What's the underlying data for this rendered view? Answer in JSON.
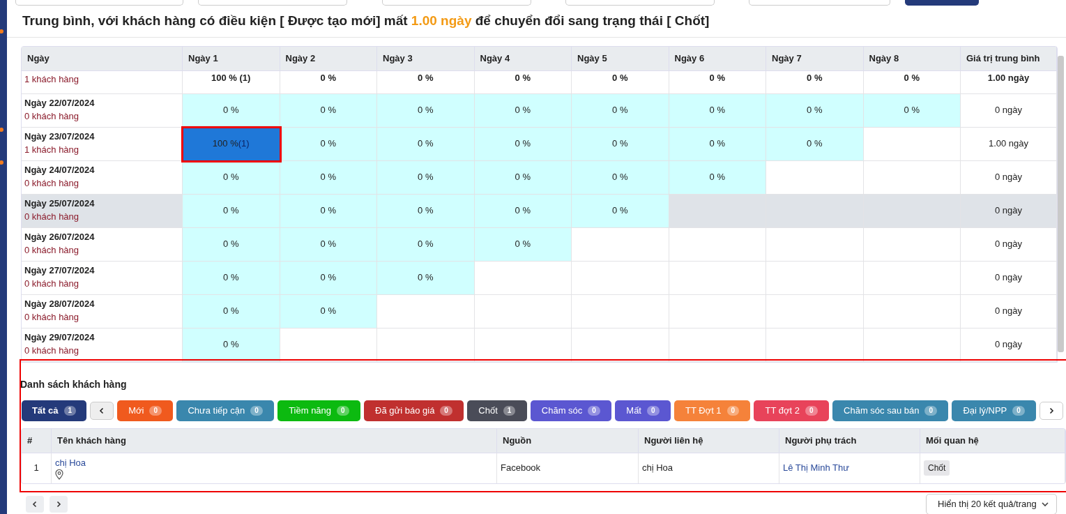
{
  "headline": {
    "before": "Trung bình, với khách hàng có điều kiện [ Được tạo mới] mất",
    "value": "1.00 ngày",
    "after": "để chuyển đổi sang trạng thái [ Chốt]"
  },
  "cohort_table": {
    "columns": [
      "Ngày",
      "Ngày 1",
      "Ngày 2",
      "Ngày 3",
      "Ngày 4",
      "Ngày 5",
      "Ngày 6",
      "Ngày 7",
      "Ngày 8",
      "Giá trị trung bình"
    ],
    "rows": [
      {
        "kind": "total",
        "hover": false,
        "count": "1 khách hàng",
        "cells": [
          {
            "text": "100 % (1)"
          },
          {
            "text": "0 %"
          },
          {
            "text": "0 %"
          },
          {
            "text": "0 %"
          },
          {
            "text": "0 %"
          },
          {
            "text": "0 %"
          },
          {
            "text": "0 %"
          },
          {
            "text": "0 %"
          }
        ],
        "average": "1.00 ngày"
      },
      {
        "kind": "day",
        "hover": false,
        "date": "Ngày 22/07/2024",
        "count": "0 khách hàng",
        "cells": [
          {
            "text": "0 %",
            "selected": false
          },
          {
            "text": "0 %",
            "selected": false
          },
          {
            "text": "0 %",
            "selected": false
          },
          {
            "text": "0 %",
            "selected": false
          },
          {
            "text": "0 %",
            "selected": false
          },
          {
            "text": "0 %",
            "selected": false
          },
          {
            "text": "0 %",
            "selected": false
          },
          {
            "text": "0 %",
            "selected": false
          }
        ],
        "average": "0 ngày"
      },
      {
        "kind": "day",
        "hover": false,
        "date": "Ngày 23/07/2024",
        "count": "1 khách hàng",
        "cells": [
          {
            "text": "100 %",
            "customers": "(1)",
            "selected": true
          },
          {
            "text": "0 %",
            "selected": false
          },
          {
            "text": "0 %",
            "selected": false
          },
          {
            "text": "0 %",
            "selected": false
          },
          {
            "text": "0 %",
            "selected": false
          },
          {
            "text": "0 %",
            "selected": false
          },
          {
            "text": "0 %",
            "selected": false
          }
        ],
        "average": "1.00 ngày"
      },
      {
        "kind": "day",
        "hover": false,
        "date": "Ngày 24/07/2024",
        "count": "0 khách hàng",
        "cells": [
          {
            "text": "0 %",
            "selected": false
          },
          {
            "text": "0 %",
            "selected": false
          },
          {
            "text": "0 %",
            "selected": false
          },
          {
            "text": "0 %",
            "selected": false
          },
          {
            "text": "0 %",
            "selected": false
          },
          {
            "text": "0 %",
            "selected": false
          }
        ],
        "average": "0 ngày"
      },
      {
        "kind": "day",
        "hover": true,
        "date": "Ngày 25/07/2024",
        "count": "0 khách hàng",
        "cells": [
          {
            "text": "0 %",
            "selected": false
          },
          {
            "text": "0 %",
            "selected": false
          },
          {
            "text": "0 %",
            "selected": false
          },
          {
            "text": "0 %",
            "selected": false
          },
          {
            "text": "0 %",
            "selected": false
          }
        ],
        "average": "0 ngày"
      },
      {
        "kind": "day",
        "hover": false,
        "date": "Ngày 26/07/2024",
        "count": "0 khách hàng",
        "cells": [
          {
            "text": "0 %",
            "selected": false
          },
          {
            "text": "0 %",
            "selected": false
          },
          {
            "text": "0 %",
            "selected": false
          },
          {
            "text": "0 %",
            "selected": false
          }
        ],
        "average": "0 ngày"
      },
      {
        "kind": "day",
        "hover": false,
        "date": "Ngày 27/07/2024",
        "count": "0 khách hàng",
        "cells": [
          {
            "text": "0 %",
            "selected": false
          },
          {
            "text": "0 %",
            "selected": false
          },
          {
            "text": "0 %",
            "selected": false
          }
        ],
        "average": "0 ngày"
      },
      {
        "kind": "day",
        "hover": false,
        "date": "Ngày 28/07/2024",
        "count": "0 khách hàng",
        "cells": [
          {
            "text": "0 %",
            "selected": false
          },
          {
            "text": "0 %",
            "selected": false
          }
        ],
        "average": "0 ngày"
      },
      {
        "kind": "day",
        "hover": false,
        "date": "Ngày 29/07/2024",
        "count": "0 khách hàng",
        "cells": [
          {
            "text": "0 %",
            "selected": false
          }
        ],
        "average": "0 ngày"
      }
    ]
  },
  "customer_list": {
    "highlighted": true,
    "title": "Danh sách khách hàng",
    "tabs": [
      {
        "label": "Tất cả",
        "count": "1",
        "color": "#243a7a",
        "selected": true
      },
      {
        "label": "Mới",
        "count": "0",
        "color": "#f05a1e",
        "selected": false
      },
      {
        "label": "Chưa tiếp cận",
        "count": "0",
        "color": "#3a87ad",
        "selected": false
      },
      {
        "label": "Tiềm năng",
        "count": "0",
        "color": "#0cba10",
        "selected": false
      },
      {
        "label": "Đã gửi báo giá",
        "count": "0",
        "color": "#c0302f",
        "selected": false
      },
      {
        "label": "Chốt",
        "count": "1",
        "color": "#4a4c58",
        "selected": false
      },
      {
        "label": "Chăm sóc",
        "count": "0",
        "color": "#5b57d1",
        "selected": false
      },
      {
        "label": "Mất",
        "count": "0",
        "color": "#5b57d1",
        "selected": false
      },
      {
        "label": "TT Đợt 1",
        "count": "0",
        "color": "#f5823a",
        "selected": false
      },
      {
        "label": "TT đợt 2",
        "count": "0",
        "color": "#e8435a",
        "selected": false
      },
      {
        "label": "Chăm sóc sau bán",
        "count": "0",
        "color": "#3a87ad",
        "selected": false
      },
      {
        "label": "Đại lý/NPP",
        "count": "0",
        "color": "#3a87ad",
        "selected": false
      }
    ],
    "columns": [
      "#",
      "Tên khách hàng",
      "Nguồn",
      "Người liên hệ",
      "Người phụ trách",
      "Mối quan hệ"
    ],
    "rows": [
      {
        "index": "1",
        "name": "chị Hoa",
        "source": "Facebook",
        "contact": "chị Hoa",
        "owner": "Lê Thị Minh Thư",
        "relation": "Chốt"
      }
    ],
    "page_size": "Hiển thị 20 kết quả/trang"
  }
}
